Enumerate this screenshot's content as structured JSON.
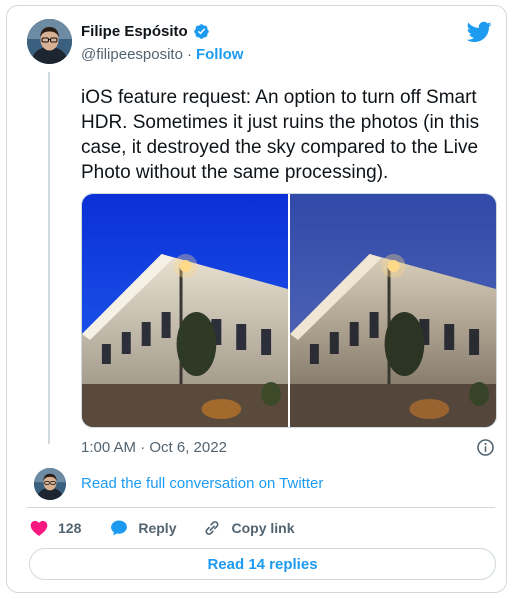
{
  "author": {
    "display_name": "Filipe Espósito",
    "handle": "@filipeesposito",
    "separator": "·",
    "follow_label": "Follow"
  },
  "tweet": {
    "text": "iOS feature request: An option to turn off Smart HDR. Sometimes it just ruins the photos (in this case, it destroyed the sky compared to the Live Photo without the same processing).",
    "timestamp": "1:00 AM · Oct 6, 2022"
  },
  "conversation": {
    "link_label": "Read the full conversation on Twitter"
  },
  "actions": {
    "like_count": "128",
    "reply_label": "Reply",
    "copy_label": "Copy link"
  },
  "replies_button": {
    "label": "Read 14 replies"
  },
  "colors": {
    "brand": "#1d9bf0",
    "like": "#f91880",
    "text_secondary": "#536471"
  },
  "icons": [
    "verified-badge-icon",
    "twitter-bird-icon",
    "info-icon",
    "heart-icon",
    "reply-bubble-icon",
    "copy-link-icon"
  ]
}
